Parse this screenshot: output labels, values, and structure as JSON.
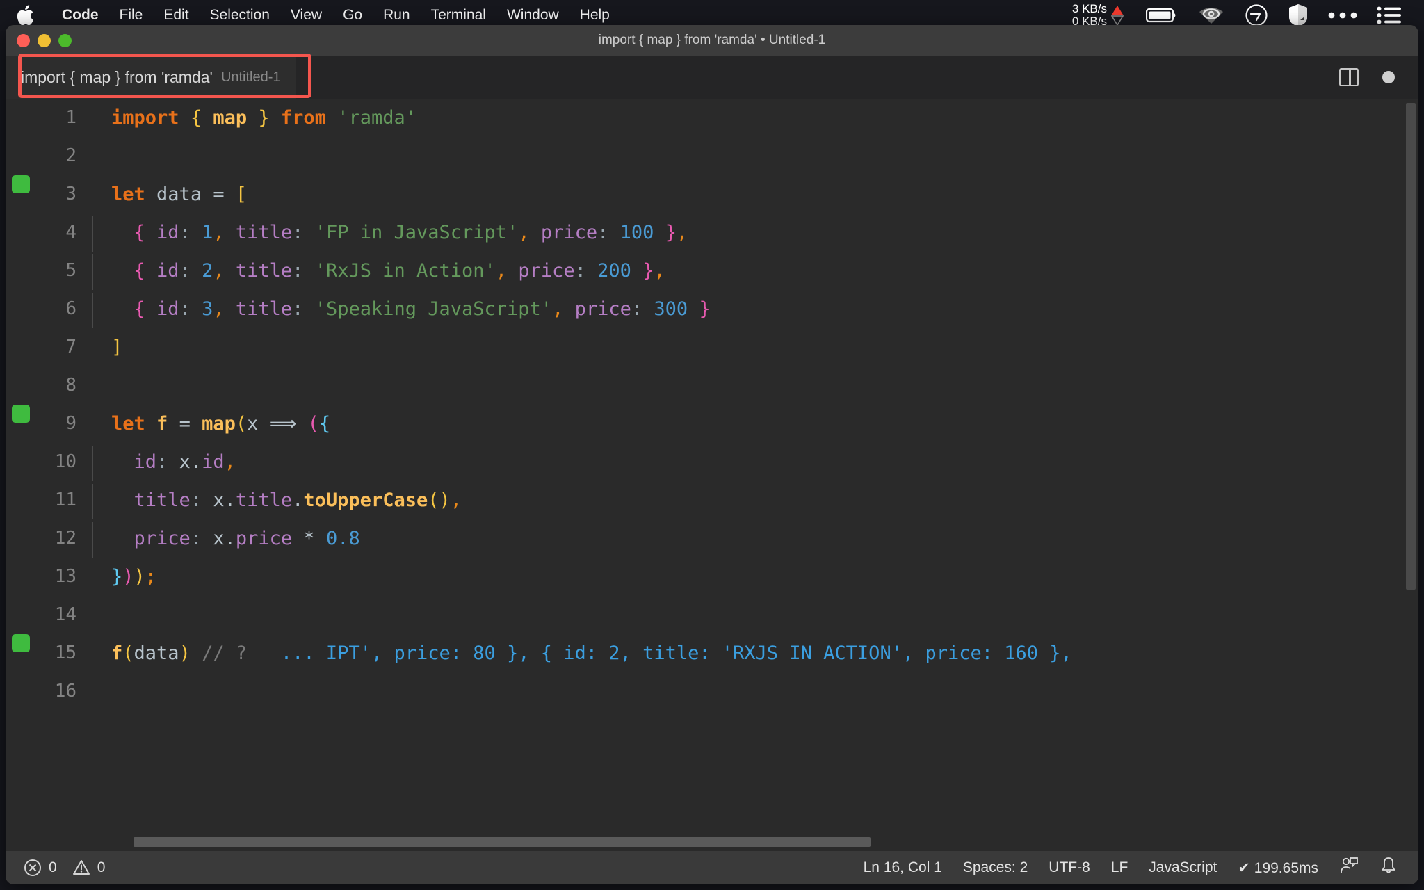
{
  "menubar": {
    "apple_icon": "apple-logo-icon",
    "items": [
      {
        "label": "Code",
        "bold": true
      },
      {
        "label": "File",
        "bold": false
      },
      {
        "label": "Edit",
        "bold": false
      },
      {
        "label": "Selection",
        "bold": false
      },
      {
        "label": "View",
        "bold": false
      },
      {
        "label": "Go",
        "bold": false
      },
      {
        "label": "Run",
        "bold": false
      },
      {
        "label": "Terminal",
        "bold": false
      },
      {
        "label": "Window",
        "bold": false
      },
      {
        "label": "Help",
        "bold": false
      }
    ],
    "network": {
      "up": "3 KB/s",
      "down": "0 KB/s",
      "up_arrow": "▲",
      "down_arrow": "▽"
    },
    "status_icons": [
      "battery-icon",
      "wifi-eye-icon",
      "clock-icon",
      "shield-icon",
      "ellipsis-icon",
      "control-center-list-icon"
    ]
  },
  "window": {
    "title": "import { map } from 'ramda' • Untitled-1",
    "traffic_lights": [
      "close-button",
      "minimize-button",
      "maximize-button"
    ]
  },
  "tabbar": {
    "tab_title": "import { map } from 'ramda'",
    "tab_subtitle": "Untitled-1",
    "highlight_color": "#f4564e",
    "actions": [
      "split-editor-icon",
      "unsaved-dot-icon"
    ]
  },
  "editor": {
    "language": "JavaScript",
    "lines": [
      {
        "n": "1",
        "marker": false,
        "indent": 0,
        "tokens": [
          {
            "t": "import",
            "c": "t-kw"
          },
          {
            "t": " ",
            "c": ""
          },
          {
            "t": "{",
            "c": "t-yellow"
          },
          {
            "t": " ",
            "c": ""
          },
          {
            "t": "map",
            "c": "t-func"
          },
          {
            "t": " ",
            "c": ""
          },
          {
            "t": "}",
            "c": "t-yellow"
          },
          {
            "t": " ",
            "c": ""
          },
          {
            "t": "from",
            "c": "t-kw"
          },
          {
            "t": " ",
            "c": ""
          },
          {
            "t": "'ramda'",
            "c": "t-str"
          }
        ]
      },
      {
        "n": "2",
        "marker": false,
        "indent": 0,
        "tokens": []
      },
      {
        "n": "3",
        "marker": true,
        "indent": 0,
        "tokens": [
          {
            "t": "let",
            "c": "t-kw"
          },
          {
            "t": " ",
            "c": ""
          },
          {
            "t": "data",
            "c": "t-var"
          },
          {
            "t": " ",
            "c": ""
          },
          {
            "t": "=",
            "c": "t-punct"
          },
          {
            "t": " ",
            "c": ""
          },
          {
            "t": "[",
            "c": "t-yellow"
          }
        ]
      },
      {
        "n": "4",
        "marker": false,
        "indent": 1,
        "tokens": [
          {
            "t": "  ",
            "c": ""
          },
          {
            "t": "{",
            "c": "t-magenta"
          },
          {
            "t": " ",
            "c": ""
          },
          {
            "t": "id",
            "c": "t-prop"
          },
          {
            "t": ":",
            "c": "t-colon"
          },
          {
            "t": " ",
            "c": ""
          },
          {
            "t": "1",
            "c": "t-num"
          },
          {
            "t": ",",
            "c": "t-comma"
          },
          {
            "t": " ",
            "c": ""
          },
          {
            "t": "title",
            "c": "t-prop"
          },
          {
            "t": ":",
            "c": "t-colon"
          },
          {
            "t": " ",
            "c": ""
          },
          {
            "t": "'FP in JavaScript'",
            "c": "t-str"
          },
          {
            "t": ",",
            "c": "t-comma"
          },
          {
            "t": " ",
            "c": ""
          },
          {
            "t": "price",
            "c": "t-prop"
          },
          {
            "t": ":",
            "c": "t-colon"
          },
          {
            "t": " ",
            "c": ""
          },
          {
            "t": "100",
            "c": "t-num"
          },
          {
            "t": " ",
            "c": ""
          },
          {
            "t": "}",
            "c": "t-magenta"
          },
          {
            "t": ",",
            "c": "t-comma"
          }
        ]
      },
      {
        "n": "5",
        "marker": false,
        "indent": 1,
        "tokens": [
          {
            "t": "  ",
            "c": ""
          },
          {
            "t": "{",
            "c": "t-magenta"
          },
          {
            "t": " ",
            "c": ""
          },
          {
            "t": "id",
            "c": "t-prop"
          },
          {
            "t": ":",
            "c": "t-colon"
          },
          {
            "t": " ",
            "c": ""
          },
          {
            "t": "2",
            "c": "t-num"
          },
          {
            "t": ",",
            "c": "t-comma"
          },
          {
            "t": " ",
            "c": ""
          },
          {
            "t": "title",
            "c": "t-prop"
          },
          {
            "t": ":",
            "c": "t-colon"
          },
          {
            "t": " ",
            "c": ""
          },
          {
            "t": "'RxJS in Action'",
            "c": "t-str"
          },
          {
            "t": ",",
            "c": "t-comma"
          },
          {
            "t": " ",
            "c": ""
          },
          {
            "t": "price",
            "c": "t-prop"
          },
          {
            "t": ":",
            "c": "t-colon"
          },
          {
            "t": " ",
            "c": ""
          },
          {
            "t": "200",
            "c": "t-num"
          },
          {
            "t": " ",
            "c": ""
          },
          {
            "t": "}",
            "c": "t-magenta"
          },
          {
            "t": ",",
            "c": "t-comma"
          }
        ]
      },
      {
        "n": "6",
        "marker": false,
        "indent": 1,
        "tokens": [
          {
            "t": "  ",
            "c": ""
          },
          {
            "t": "{",
            "c": "t-magenta"
          },
          {
            "t": " ",
            "c": ""
          },
          {
            "t": "id",
            "c": "t-prop"
          },
          {
            "t": ":",
            "c": "t-colon"
          },
          {
            "t": " ",
            "c": ""
          },
          {
            "t": "3",
            "c": "t-num"
          },
          {
            "t": ",",
            "c": "t-comma"
          },
          {
            "t": " ",
            "c": ""
          },
          {
            "t": "title",
            "c": "t-prop"
          },
          {
            "t": ":",
            "c": "t-colon"
          },
          {
            "t": " ",
            "c": ""
          },
          {
            "t": "'Speaking JavaScript'",
            "c": "t-str"
          },
          {
            "t": ",",
            "c": "t-comma"
          },
          {
            "t": " ",
            "c": ""
          },
          {
            "t": "price",
            "c": "t-prop"
          },
          {
            "t": ":",
            "c": "t-colon"
          },
          {
            "t": " ",
            "c": ""
          },
          {
            "t": "300",
            "c": "t-num"
          },
          {
            "t": " ",
            "c": ""
          },
          {
            "t": "}",
            "c": "t-magenta"
          }
        ]
      },
      {
        "n": "7",
        "marker": false,
        "indent": 0,
        "tokens": [
          {
            "t": "]",
            "c": "t-yellow"
          }
        ]
      },
      {
        "n": "8",
        "marker": false,
        "indent": 0,
        "tokens": []
      },
      {
        "n": "9",
        "marker": true,
        "indent": 0,
        "tokens": [
          {
            "t": "let",
            "c": "t-kw"
          },
          {
            "t": " ",
            "c": ""
          },
          {
            "t": "f",
            "c": "t-func"
          },
          {
            "t": " ",
            "c": ""
          },
          {
            "t": "=",
            "c": "t-punct"
          },
          {
            "t": " ",
            "c": ""
          },
          {
            "t": "map",
            "c": "t-func"
          },
          {
            "t": "(",
            "c": "t-yellow"
          },
          {
            "t": "x",
            "c": "t-var"
          },
          {
            "t": " ",
            "c": ""
          },
          {
            "t": "⟹",
            "c": "t-punct"
          },
          {
            "t": " ",
            "c": ""
          },
          {
            "t": "(",
            "c": "t-magenta"
          },
          {
            "t": "{",
            "c": "t-cyan"
          }
        ]
      },
      {
        "n": "10",
        "marker": false,
        "indent": 1,
        "tokens": [
          {
            "t": "  ",
            "c": ""
          },
          {
            "t": "id",
            "c": "t-prop"
          },
          {
            "t": ":",
            "c": "t-colon"
          },
          {
            "t": " ",
            "c": ""
          },
          {
            "t": "x",
            "c": "t-var"
          },
          {
            "t": ".",
            "c": "t-punct"
          },
          {
            "t": "id",
            "c": "t-prop"
          },
          {
            "t": ",",
            "c": "t-comma"
          }
        ]
      },
      {
        "n": "11",
        "marker": false,
        "indent": 1,
        "tokens": [
          {
            "t": "  ",
            "c": ""
          },
          {
            "t": "title",
            "c": "t-prop"
          },
          {
            "t": ":",
            "c": "t-colon"
          },
          {
            "t": " ",
            "c": ""
          },
          {
            "t": "x",
            "c": "t-var"
          },
          {
            "t": ".",
            "c": "t-punct"
          },
          {
            "t": "title",
            "c": "t-prop"
          },
          {
            "t": ".",
            "c": "t-punct"
          },
          {
            "t": "toUpperCase",
            "c": "t-func"
          },
          {
            "t": "(",
            "c": "t-yellow"
          },
          {
            "t": ")",
            "c": "t-yellow"
          },
          {
            "t": ",",
            "c": "t-comma"
          }
        ]
      },
      {
        "n": "12",
        "marker": false,
        "indent": 1,
        "tokens": [
          {
            "t": "  ",
            "c": ""
          },
          {
            "t": "price",
            "c": "t-prop"
          },
          {
            "t": ":",
            "c": "t-colon"
          },
          {
            "t": " ",
            "c": ""
          },
          {
            "t": "x",
            "c": "t-var"
          },
          {
            "t": ".",
            "c": "t-punct"
          },
          {
            "t": "price",
            "c": "t-prop"
          },
          {
            "t": " ",
            "c": ""
          },
          {
            "t": "*",
            "c": "t-punct"
          },
          {
            "t": " ",
            "c": ""
          },
          {
            "t": "0.8",
            "c": "t-num"
          }
        ]
      },
      {
        "n": "13",
        "marker": false,
        "indent": 0,
        "tokens": [
          {
            "t": "}",
            "c": "t-cyan"
          },
          {
            "t": ")",
            "c": "t-magenta"
          },
          {
            "t": ")",
            "c": "t-yellow"
          },
          {
            "t": ";",
            "c": "t-comma"
          }
        ]
      },
      {
        "n": "14",
        "marker": false,
        "indent": 0,
        "tokens": []
      },
      {
        "n": "15",
        "marker": true,
        "indent": 0,
        "tokens": [
          {
            "t": "f",
            "c": "t-func"
          },
          {
            "t": "(",
            "c": "t-yellow"
          },
          {
            "t": "data",
            "c": "t-var"
          },
          {
            "t": ")",
            "c": "t-yellow"
          },
          {
            "t": " ",
            "c": ""
          },
          {
            "t": "// ?",
            "c": "t-comment"
          },
          {
            "t": "   ",
            "c": ""
          },
          {
            "t": "... IPT', price: 80 }, { id: 2, title: 'RXJS IN ACTION', price: 160 },",
            "c": "t-inline"
          }
        ]
      },
      {
        "n": "16",
        "marker": false,
        "indent": 0,
        "tokens": []
      }
    ]
  },
  "statusbar": {
    "errors": "0",
    "warnings": "0",
    "position": "Ln 16, Col 1",
    "spaces": "Spaces: 2",
    "encoding": "UTF-8",
    "eol": "LF",
    "language": "JavaScript",
    "runtime": "✔ 199.65ms",
    "icons": [
      "error-icon",
      "warning-icon",
      "feedback-icon",
      "bell-icon"
    ]
  }
}
